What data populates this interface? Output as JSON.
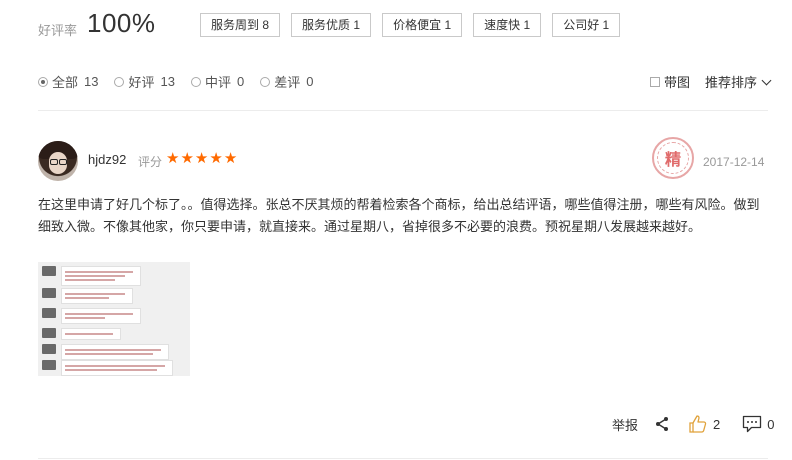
{
  "summary": {
    "rate_label": "好评率",
    "rate_value": "100%",
    "tags": [
      {
        "label": "服务周到",
        "count": "8"
      },
      {
        "label": "服务优质",
        "count": "1"
      },
      {
        "label": "价格便宜",
        "count": "1"
      },
      {
        "label": "速度快",
        "count": "1"
      },
      {
        "label": "公司好",
        "count": "1"
      }
    ]
  },
  "filters": [
    {
      "label": "全部",
      "count": "13",
      "checked": true
    },
    {
      "label": "好评",
      "count": "13",
      "checked": false
    },
    {
      "label": "中评",
      "count": "0",
      "checked": false
    },
    {
      "label": "差评",
      "count": "0",
      "checked": false
    }
  ],
  "options": {
    "with_pic": "带图",
    "sort": "推荐排序"
  },
  "review": {
    "username": "hjdz92",
    "score_label": "评分",
    "stars": 5,
    "seal": "精",
    "date": "2017-12-14",
    "content": "在这里申请了好几个标了。。值得选择。张总不厌其烦的帮着检索各个商标，给出总结评语，哪些值得注册，哪些有风险。做到细致入微。不像其他家，你只要申请，就直接来。通过星期八，省掉很多不必要的浪费。预祝星期八发展越来越好。",
    "actions": {
      "report": "举报",
      "likes": "2",
      "comments": "0"
    }
  },
  "colors": {
    "star": "#ff6a00",
    "like_icon": "#e0a23b",
    "seal": "#e06b6b"
  }
}
